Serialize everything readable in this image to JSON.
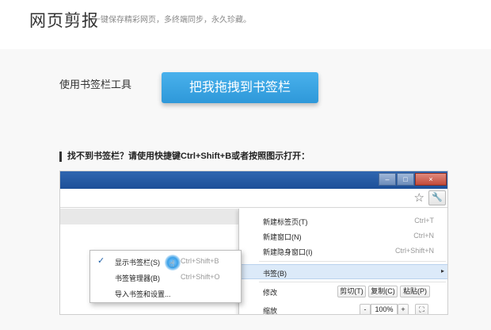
{
  "header": {
    "logo": "网页剪报",
    "slogan": "一键保存精彩网页，多终端同步，永久珍藏。"
  },
  "main": {
    "tool_label": "使用书签栏工具",
    "drag_button": "把我拖拽到书签栏",
    "hint": "找不到书签栏？请使用快捷键Ctrl+Shift+B或者按照图示打开："
  },
  "browser": {
    "window_controls": [
      "–",
      "□",
      "×"
    ],
    "star_icon": "star-icon",
    "wrench_icon": "wrench-icon",
    "menu": {
      "new_tab": {
        "label": "新建标签页(T)",
        "shortcut": "Ctrl+T"
      },
      "new_window": {
        "label": "新建窗口(N)",
        "shortcut": "Ctrl+N"
      },
      "new_incognito": {
        "label": "新建隐身窗口(I)",
        "shortcut": "Ctrl+Shift+N"
      },
      "bookmarks": {
        "label": "书签(B)",
        "arrow": "▸"
      },
      "edit": {
        "label": "修改",
        "cut": "剪切(T)",
        "copy": "复制(C)",
        "paste": "粘贴(P)"
      },
      "zoom": {
        "label": "缩放",
        "minus": "-",
        "value": "100%",
        "plus": "+"
      }
    },
    "submenu": {
      "show_bar": {
        "check": "✓",
        "label": "显示书签栏(S)",
        "shortcut": "Ctrl+Shift+B"
      },
      "manager": {
        "label": "书签管理器(B)",
        "shortcut": "Ctrl+Shift+O"
      },
      "import": {
        "label": "导入书签和设置..."
      }
    }
  }
}
